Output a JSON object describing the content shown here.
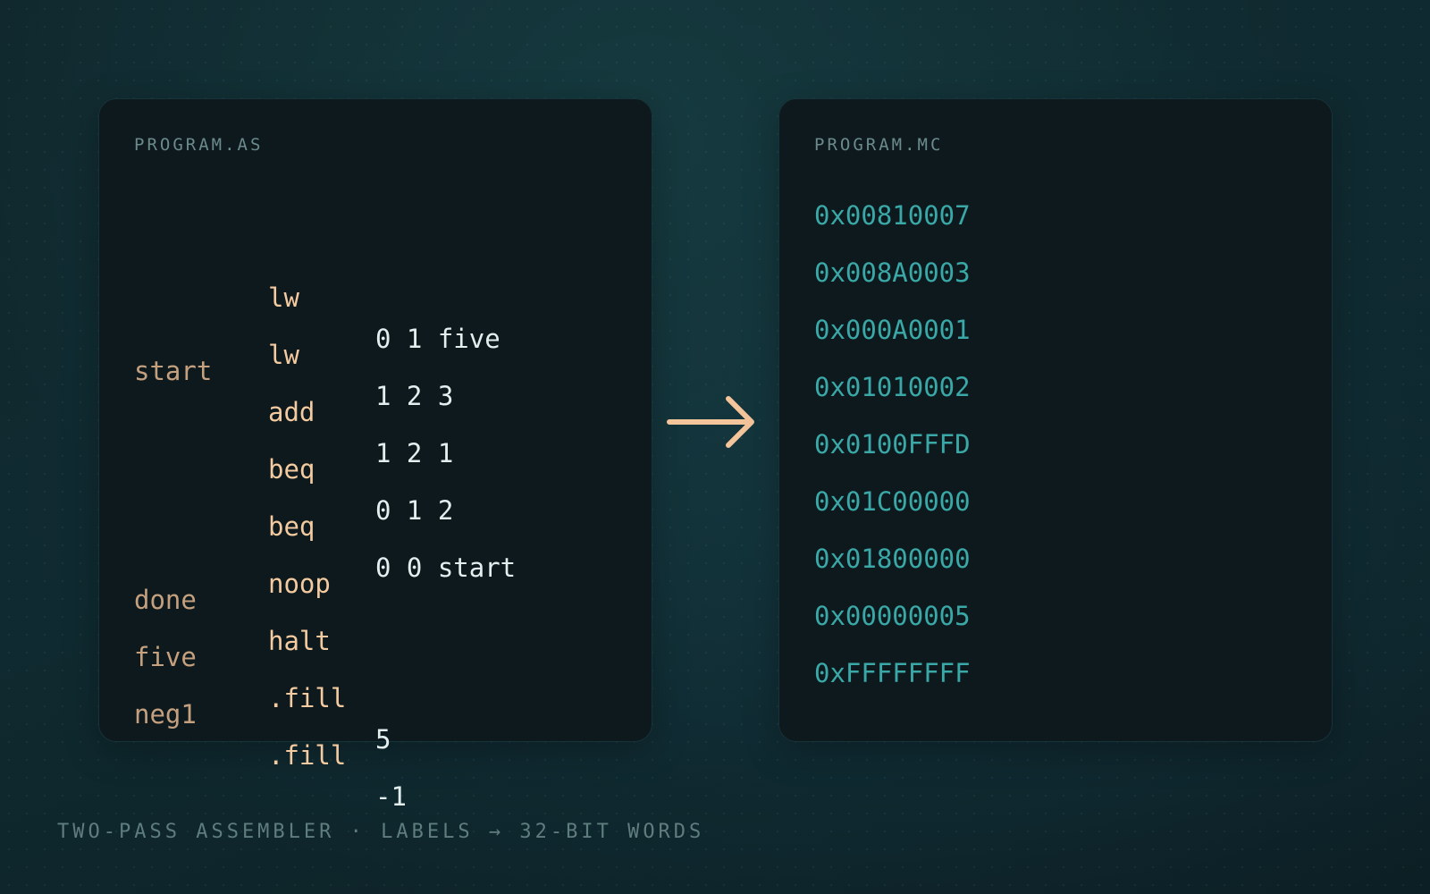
{
  "source_panel": {
    "title": "PROGRAM.AS",
    "lines": [
      {
        "label": "",
        "op": "lw",
        "args": "0 1 five"
      },
      {
        "label": "",
        "op": "lw",
        "args": "1 2 3"
      },
      {
        "label": "start",
        "op": "add",
        "args": "1 2 1"
      },
      {
        "label": "",
        "op": "beq",
        "args": "0 1 2"
      },
      {
        "label": "",
        "op": "beq",
        "args": "0 0 start"
      },
      {
        "label": "",
        "op": "noop",
        "args": ""
      },
      {
        "label": "done",
        "op": "halt",
        "args": ""
      },
      {
        "label": "five",
        "op": ".fill",
        "args": "5"
      },
      {
        "label": "neg1",
        "op": ".fill",
        "args": "-1"
      }
    ]
  },
  "output_panel": {
    "title": "PROGRAM.MC",
    "words": [
      "0x00810007",
      "0x008A0003",
      "0x000A0001",
      "0x01010002",
      "0x0100FFFD",
      "0x01C00000",
      "0x01800000",
      "0x00000005",
      "0xFFFFFFFF"
    ]
  },
  "arrow_icon": "arrow-right-icon",
  "footer": {
    "caption": "TWO-PASS ASSEMBLER · LABELS → 32-BIT WORDS"
  },
  "colors": {
    "label": "#c4a07f",
    "opcode": "#f4caa0",
    "args": "#e3eeee",
    "hex": "#3aa8a7",
    "arrow": "#f4c49a"
  }
}
